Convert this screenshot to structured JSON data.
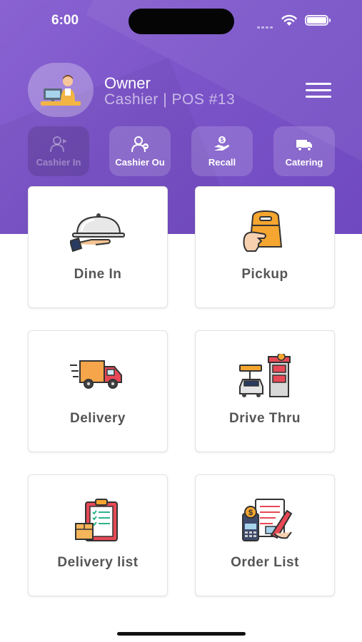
{
  "status": {
    "time": "6:00"
  },
  "profile": {
    "name": "Owner",
    "role": "Cashier | POS #13"
  },
  "quick_actions": [
    {
      "label": "Cashier In",
      "icon": "cashier-in-icon",
      "enabled": false
    },
    {
      "label": "Cashier Ou",
      "icon": "cashier-out-icon",
      "enabled": true
    },
    {
      "label": "Recall",
      "icon": "recall-icon",
      "enabled": true
    },
    {
      "label": "Catering",
      "icon": "catering-icon",
      "enabled": true
    }
  ],
  "cards": [
    {
      "label": "Dine In",
      "icon": "cloche-icon"
    },
    {
      "label": "Pickup",
      "icon": "pickup-bag-icon"
    },
    {
      "label": "Delivery",
      "icon": "delivery-truck-icon"
    },
    {
      "label": "Drive Thru",
      "icon": "drive-thru-icon"
    },
    {
      "label": "Delivery list",
      "icon": "clipboard-checklist-icon"
    },
    {
      "label": "Order List",
      "icon": "order-list-icon"
    }
  ],
  "colors": {
    "brand": "#7b54c9",
    "card_text": "#555555"
  }
}
